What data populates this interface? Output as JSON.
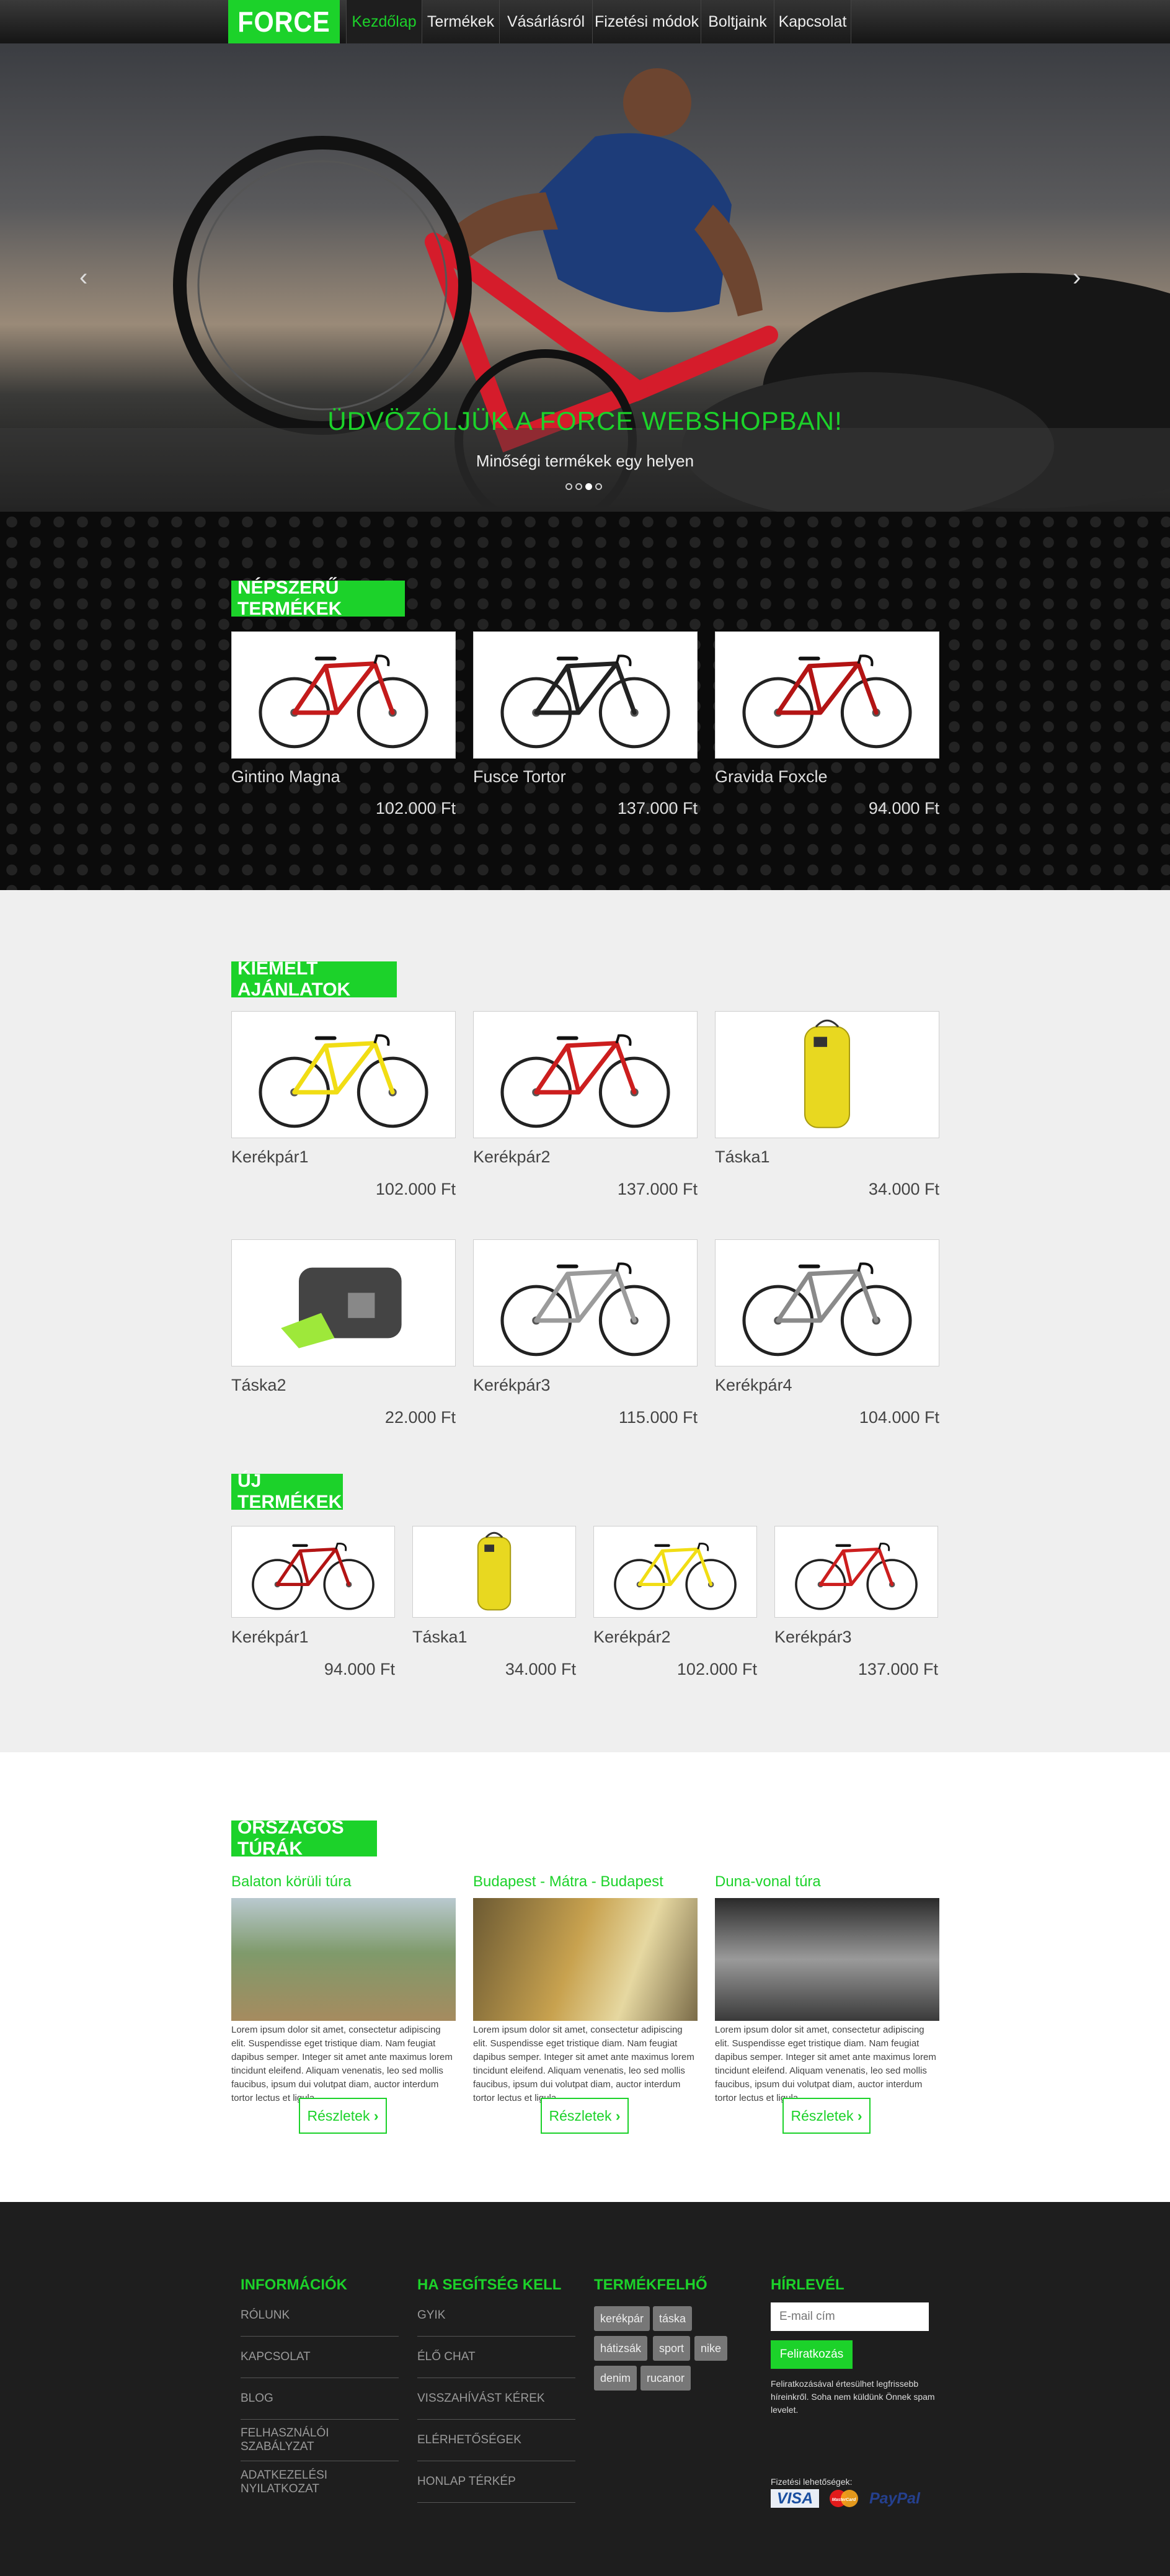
{
  "nav": {
    "logo": "FORCE",
    "items": [
      "Kezdőlap",
      "Termékek",
      "Vásárlásról",
      "Fizetési módok",
      "Boltjaink",
      "Kapcsolat"
    ],
    "active_index": 0
  },
  "hero": {
    "title": "ÜDVÖZÖLJÜK A FORCE WEBSHOPBAN!",
    "subtitle": "Minőségi termékek egy helyen",
    "prev_icon": "chevron-left-icon",
    "next_icon": "chevron-right-icon",
    "slides": 4,
    "active_slide": 2
  },
  "popular": {
    "title": "NÉPSZERŰ TERMÉKEK",
    "products": [
      {
        "name": "Gintino Magna",
        "price": "102.000 Ft",
        "color": "#c41b1b"
      },
      {
        "name": "Fusce Tortor",
        "price": "137.000 Ft",
        "color": "#222222"
      },
      {
        "name": "Gravida Foxcle",
        "price": "94.000 Ft",
        "color": "#b31414"
      }
    ]
  },
  "featured": {
    "title": "KIEMELT AJÁNLATOK",
    "products": [
      {
        "name": "Kerékpár1",
        "price": "102.000 Ft",
        "color": "#f1dd14",
        "kind": "bike"
      },
      {
        "name": "Kerékpár2",
        "price": "137.000 Ft",
        "color": "#cc1e1e",
        "kind": "bike"
      },
      {
        "name": "Táska1",
        "price": "34.000 Ft",
        "color": "#e8d820",
        "kind": "backpack"
      },
      {
        "name": "Táska2",
        "price": "22.000 Ft",
        "color": "#444444",
        "kind": "bag"
      },
      {
        "name": "Kerékpár3",
        "price": "115.000 Ft",
        "color": "#9b9b9b",
        "kind": "bike"
      },
      {
        "name": "Kerékpár4",
        "price": "104.000 Ft",
        "color": "#8a8a8a",
        "kind": "bike"
      }
    ]
  },
  "new_products": {
    "title": "ÚJ TERMÉKEK",
    "products": [
      {
        "name": "Kerékpár1",
        "price": "94.000 Ft",
        "color": "#b31414",
        "kind": "bike"
      },
      {
        "name": "Táska1",
        "price": "34.000 Ft",
        "color": "#e8d820",
        "kind": "backpack"
      },
      {
        "name": "Kerékpár2",
        "price": "102.000 Ft",
        "color": "#f1dd14",
        "kind": "bike"
      },
      {
        "name": "Kerékpár3",
        "price": "137.000 Ft",
        "color": "#cc1e1e",
        "kind": "bike"
      }
    ]
  },
  "tours": {
    "title": "ORSZÁGOS TÚRÁK",
    "items": [
      {
        "title": "Balaton körüli túra",
        "text": "Lorem ipsum dolor sit amet, consectetur adipiscing elit. Suspendisse eget tristique diam. Nam feugiat dapibus semper. Integer sit amet ante maximus lorem tincidunt eleifend. Aliquam venenatis, leo sed mollis faucibus, ipsum dui volutpat diam, auctor interdum tortor lectus et ligula.",
        "button": "Részletek"
      },
      {
        "title": "Budapest - Mátra - Budapest",
        "text": "Lorem ipsum dolor sit amet, consectetur adipiscing elit. Suspendisse eget tristique diam. Nam feugiat dapibus semper. Integer sit amet ante maximus lorem tincidunt eleifend. Aliquam venenatis, leo sed mollis faucibus, ipsum dui volutpat diam, auctor interdum tortor lectus et ligula.",
        "button": "Részletek"
      },
      {
        "title": "Duna-vonal túra",
        "text": "Lorem ipsum dolor sit amet, consectetur adipiscing elit. Suspendisse eget tristique diam. Nam feugiat dapibus semper. Integer sit amet ante maximus lorem tincidunt eleifend. Aliquam venenatis, leo sed mollis faucibus, ipsum dui volutpat diam, auctor interdum tortor lectus et ligula.",
        "button": "Részletek"
      }
    ]
  },
  "footer": {
    "info": {
      "title": "INFORMÁCIÓK",
      "links": [
        "RÓLUNK",
        "KAPCSOLAT",
        "BLOG",
        "FELHASZNÁLÓI SZABÁLYZAT",
        "ADATKEZELÉSI NYILATKOZAT"
      ]
    },
    "help": {
      "title": "HA SEGÍTSÉG KELL",
      "links": [
        "GYIK",
        "ÉLŐ CHAT",
        "VISSZAHÍVÁST KÉREK",
        "ELÉRHETŐSÉGEK",
        "HONLAP TÉRKÉP"
      ]
    },
    "tags": {
      "title": "TERMÉKFELHŐ",
      "items": [
        "kerékpár",
        "táska",
        "hátizsák",
        "sport",
        "nike",
        "denim",
        "rucanor"
      ]
    },
    "newsletter": {
      "title": "HÍRLEVÉL",
      "placeholder": "E-mail cím",
      "button": "Feliratkozás",
      "note": "Feliratkozásával értesülhet legfrissebb híreinkről. Soha nem küldünk Önnek spam levelet.",
      "payment_label": "Fizetési lehetőségek:",
      "payments": [
        "VISA",
        "MasterCard",
        "PayPal"
      ]
    }
  },
  "colors": {
    "accent": "#1cd22a",
    "footer_bg": "#1e1e1e",
    "dark_bg": "#0b0b0b"
  }
}
